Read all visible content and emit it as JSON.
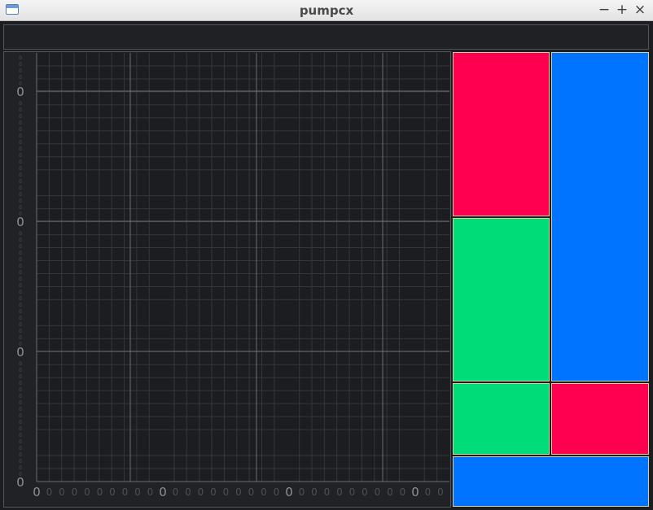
{
  "window": {
    "title": "pumpcx",
    "minimize_label": "−",
    "maximize_label": "+",
    "close_label": "×",
    "app_icon": "window-icon"
  },
  "chart_data": {
    "type": "line",
    "title": "",
    "xlabel": "",
    "ylabel": "",
    "x_major_tick_labels": [
      "0",
      "0",
      "0",
      "0"
    ],
    "x_minor_tick_labels": [
      "0",
      "0",
      "0",
      "0",
      "0",
      "0",
      "0",
      "0",
      "0",
      "0",
      "0",
      "0",
      "0",
      "0",
      "0",
      "0",
      "0",
      "0",
      "0",
      "0",
      "0",
      "0",
      "0",
      "0",
      "0",
      "0",
      "0",
      "0",
      "0",
      "0",
      "0",
      "0",
      "0",
      "0"
    ],
    "y_major_tick_labels": [
      "0",
      "0",
      "0",
      "0"
    ],
    "y_minor_tick_labels": [
      "0",
      "0",
      "0",
      "0",
      "0",
      "0",
      "0",
      "0",
      "0",
      "0",
      "0",
      "0",
      "0",
      "0",
      "0",
      "0",
      "0",
      "0",
      "0",
      "0",
      "0",
      "0",
      "0",
      "0",
      "0",
      "0",
      "0",
      "0",
      "0",
      "0",
      "0",
      "0",
      "0",
      "0",
      "0",
      "0",
      "0",
      "0",
      "0",
      "0",
      "0",
      "0",
      "0",
      "0",
      "0",
      "0",
      "0",
      "0",
      "0",
      "0",
      "0",
      "0",
      "0",
      "0",
      "0",
      "0",
      "0",
      "0",
      "0",
      "0",
      "0",
      "0",
      "0",
      "0"
    ],
    "grid": true,
    "series": []
  },
  "colors": {
    "red": "#ff0050",
    "green": "#00dc78",
    "blue": "#0073ff",
    "plot_background": "#1b1d21",
    "grid_major": "#6a6e74",
    "grid_minor": "#34373c",
    "tick_major": "#8d9197",
    "tick_minor": "#4c4f55"
  },
  "tiles": [
    {
      "name": "tile-red-top",
      "color": "red"
    },
    {
      "name": "tile-blue-tall",
      "color": "blue"
    },
    {
      "name": "tile-green-middle",
      "color": "green"
    },
    {
      "name": "tile-green-small",
      "color": "green"
    },
    {
      "name": "tile-red-small",
      "color": "red"
    },
    {
      "name": "tile-blue-bottom",
      "color": "blue"
    }
  ]
}
